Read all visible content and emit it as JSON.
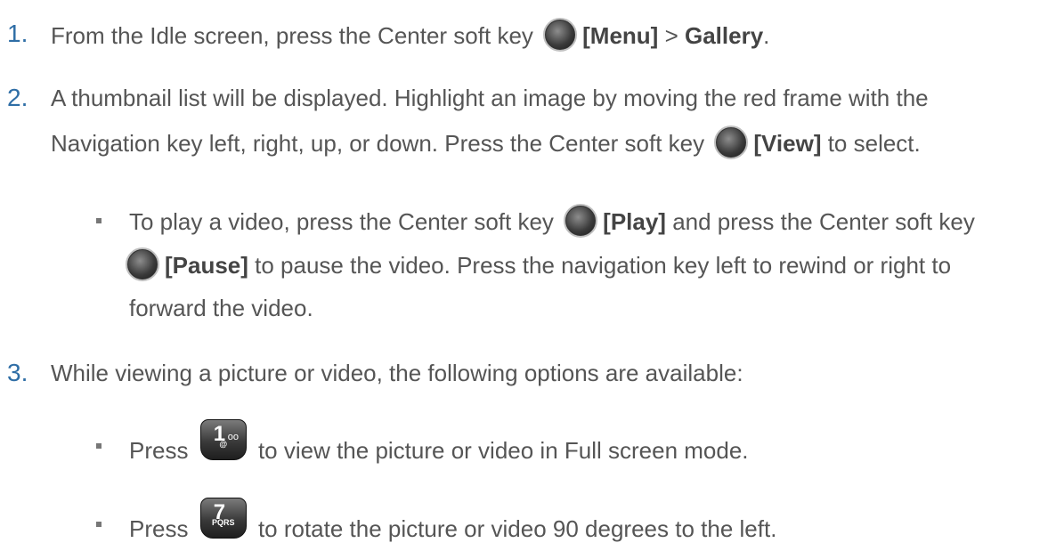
{
  "steps": [
    {
      "number": "1.",
      "lines": [
        {
          "a": "From the Idle screen, press the Center soft key",
          "b": "[Menu]",
          "c": " > ",
          "d": "Gallery",
          "e": "."
        }
      ]
    },
    {
      "number": "2.",
      "line1": "A thumbnail list will be displayed. Highlight an image by moving the red frame with the",
      "line2a": "Navigation key left, right, up, or down. Press the Center soft key",
      "line2b": "[View]",
      "line2c": " to select."
    },
    {
      "number": "3.",
      "line1": "While viewing a picture or video, the following options are available:"
    }
  ],
  "bullet1": {
    "l1a": "To play a video, press the Center soft key",
    "l1b": "[Play]",
    "l1c": " and press the Center soft key",
    "l2b": "[Pause]",
    "l2c": " to pause the video. Press the navigation key left to rewind or right to",
    "l3": "forward the video."
  },
  "bullet2": {
    "a": "Press",
    "b": "to view the picture or video in Full screen mode.",
    "key_big": "1",
    "key_small": "oo",
    "key_bottom": "@"
  },
  "bullet3": {
    "a": "Press",
    "b": "to rotate the picture or video 90 degrees to the left.",
    "key_big": "7",
    "key_bottom": "PQRS"
  }
}
